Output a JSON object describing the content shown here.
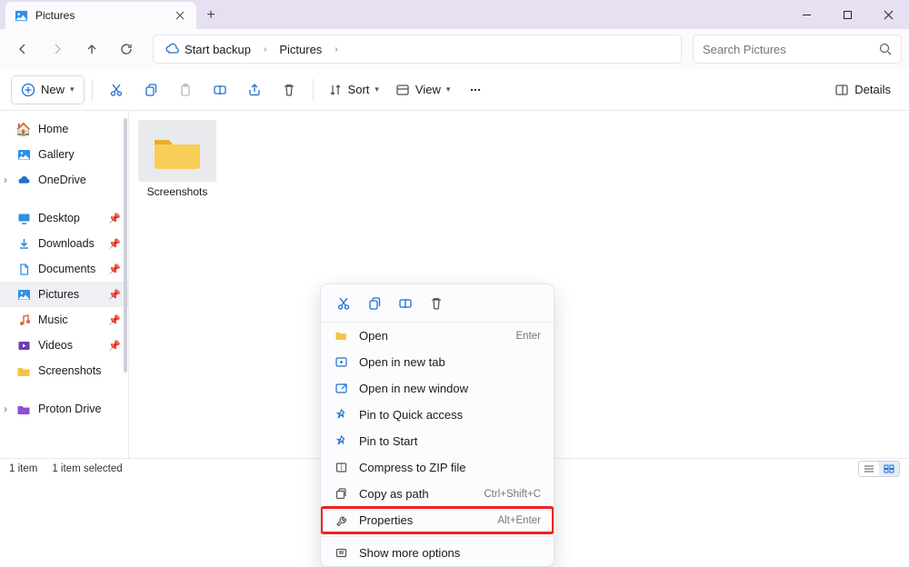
{
  "window": {
    "tab_title": "Pictures"
  },
  "address": {
    "backup_label": "Start backup",
    "crumb1": "Pictures"
  },
  "search": {
    "placeholder": "Search Pictures"
  },
  "toolbar": {
    "new_label": "New",
    "sort_label": "Sort",
    "view_label": "View",
    "details_label": "Details"
  },
  "sidebar": {
    "home": "Home",
    "gallery": "Gallery",
    "onedrive": "OneDrive",
    "desktop": "Desktop",
    "downloads": "Downloads",
    "documents": "Documents",
    "pictures": "Pictures",
    "music": "Music",
    "videos": "Videos",
    "screenshots": "Screenshots",
    "proton": "Proton Drive"
  },
  "content": {
    "items": [
      {
        "name": "Screenshots"
      }
    ]
  },
  "context_menu": {
    "open": "Open",
    "open_shortcut": "Enter",
    "open_new_tab": "Open in new tab",
    "open_new_window": "Open in new window",
    "pin_quick": "Pin to Quick access",
    "pin_start": "Pin to Start",
    "compress": "Compress to ZIP file",
    "copy_path": "Copy as path",
    "copy_path_shortcut": "Ctrl+Shift+C",
    "properties": "Properties",
    "properties_shortcut": "Alt+Enter",
    "show_more": "Show more options"
  },
  "status": {
    "count": "1 item",
    "selected": "1 item selected"
  }
}
